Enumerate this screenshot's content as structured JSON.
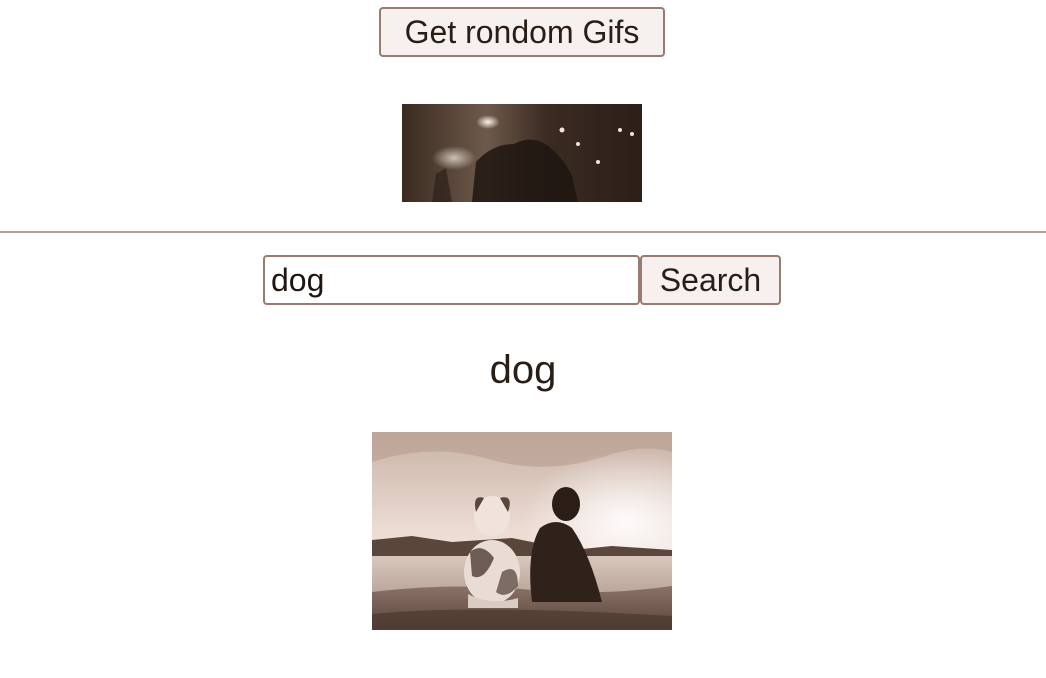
{
  "random": {
    "button_label": "Get rondom Gifs",
    "gif_icon": "concert-stage-gif"
  },
  "search": {
    "input_value": "dog",
    "button_label": "Search",
    "result_title": "dog",
    "gif_icon": "dog-and-person-by-lake-gif"
  },
  "colors": {
    "border": "#9a7b6f",
    "button_bg": "#f6f1ef",
    "divider": "#b59f97",
    "text": "#2a1d16"
  }
}
